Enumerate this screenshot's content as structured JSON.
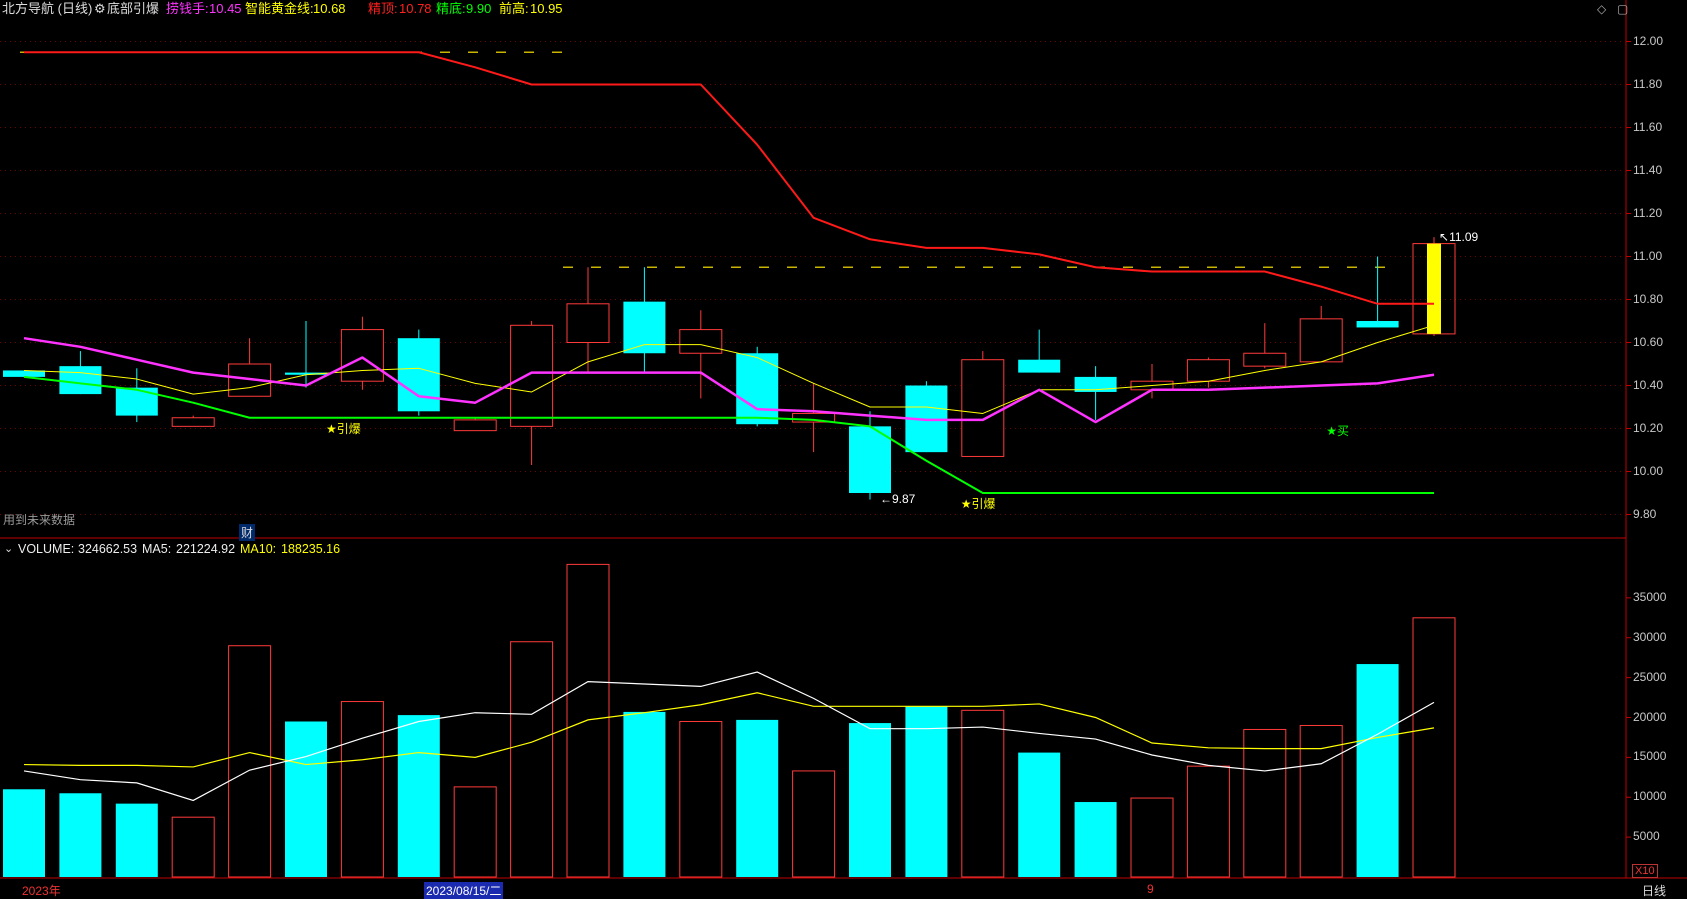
{
  "header": {
    "title": "北方导航 (日线)",
    "indicator_name": "底部引爆",
    "items": [
      {
        "label": "捞钱手:",
        "value": "10.45",
        "color": "#ff33ff"
      },
      {
        "label": "智能黄金线:",
        "value": "10.68",
        "color": "#ffff00"
      },
      {
        "label": "精顶:",
        "value": "10.78",
        "color": "#ff2020"
      },
      {
        "label": "精底:",
        "value": "9.90",
        "color": "#00ff00"
      },
      {
        "label": "前高:",
        "value": "10.95",
        "color": "#ffff00"
      }
    ]
  },
  "volume_header": {
    "label": "VOLUME:",
    "value": "324662.53",
    "ma5_label": "MA5:",
    "ma5_value": "221224.92",
    "ma10_label": "MA10:",
    "ma10_value": "188235.16"
  },
  "annotations": {
    "future_data": "用到未来数据",
    "finance_marker": "财",
    "ignite1": "★引爆",
    "ignite2": "★引爆",
    "buy": "★买",
    "high_label": "11.09",
    "low_label": "9.87",
    "x10": "X10",
    "period": "日线"
  },
  "x_axis": {
    "year": "2023年",
    "cursor_date": "2023/08/15/二",
    "month": "9"
  },
  "price_axis": [
    "12.00",
    "11.80",
    "11.60",
    "11.40",
    "11.20",
    "11.00",
    "10.80",
    "10.60",
    "10.40",
    "10.20",
    "10.00",
    "9.80"
  ],
  "volume_axis": [
    "35000",
    "30000",
    "25000",
    "20000",
    "15000",
    "10000",
    "5000"
  ],
  "colors": {
    "up": "#ff3a3a",
    "down": "#00ffff",
    "last": "#ffff00",
    "grid": "#6e0000",
    "axis": "#c00000"
  },
  "chart_data": {
    "type": "candlestick",
    "candles": [
      {
        "o": 10.47,
        "h": 10.47,
        "l": 10.44,
        "c": 10.44
      },
      {
        "o": 10.49,
        "h": 10.56,
        "l": 10.36,
        "c": 10.36
      },
      {
        "o": 10.39,
        "h": 10.48,
        "l": 10.23,
        "c": 10.26
      },
      {
        "o": 10.21,
        "h": 10.26,
        "l": 10.21,
        "c": 10.25
      },
      {
        "o": 10.35,
        "h": 10.62,
        "l": 10.35,
        "c": 10.5
      },
      {
        "o": 10.46,
        "h": 10.7,
        "l": 10.39,
        "c": 10.45
      },
      {
        "o": 10.42,
        "h": 10.72,
        "l": 10.38,
        "c": 10.66
      },
      {
        "o": 10.62,
        "h": 10.66,
        "l": 10.26,
        "c": 10.28
      },
      {
        "o": 10.19,
        "h": 10.25,
        "l": 10.19,
        "c": 10.24
      },
      {
        "o": 10.21,
        "h": 10.7,
        "l": 10.03,
        "c": 10.68
      },
      {
        "o": 10.6,
        "h": 10.95,
        "l": 10.46,
        "c": 10.78
      },
      {
        "o": 10.79,
        "h": 10.95,
        "l": 10.46,
        "c": 10.55
      },
      {
        "o": 10.55,
        "h": 10.75,
        "l": 10.34,
        "c": 10.66
      },
      {
        "o": 10.55,
        "h": 10.58,
        "l": 10.21,
        "c": 10.22
      },
      {
        "o": 10.23,
        "h": 10.41,
        "l": 10.09,
        "c": 10.27
      },
      {
        "o": 10.21,
        "h": 10.28,
        "l": 9.87,
        "c": 9.9
      },
      {
        "o": 10.4,
        "h": 10.42,
        "l": 10.09,
        "c": 10.09
      },
      {
        "o": 10.07,
        "h": 10.56,
        "l": 10.07,
        "c": 10.52
      },
      {
        "o": 10.52,
        "h": 10.66,
        "l": 10.46,
        "c": 10.46
      },
      {
        "o": 10.44,
        "h": 10.49,
        "l": 10.24,
        "c": 10.37
      },
      {
        "o": 10.38,
        "h": 10.5,
        "l": 10.34,
        "c": 10.42
      },
      {
        "o": 10.42,
        "h": 10.53,
        "l": 10.39,
        "c": 10.52
      },
      {
        "o": 10.49,
        "h": 10.69,
        "l": 10.48,
        "c": 10.55
      },
      {
        "o": 10.51,
        "h": 10.77,
        "l": 10.51,
        "c": 10.71
      },
      {
        "o": 10.7,
        "h": 11.0,
        "l": 10.68,
        "c": 10.67
      },
      {
        "o": 10.64,
        "h": 11.09,
        "l": 10.63,
        "c": 11.06
      }
    ],
    "jingding": [
      11.95,
      11.95,
      11.95,
      11.95,
      11.95,
      11.95,
      11.95,
      11.95,
      11.88,
      11.8,
      11.8,
      11.8,
      11.8,
      11.52,
      11.18,
      11.08,
      11.04,
      11.04,
      11.01,
      10.95,
      10.93,
      10.93,
      10.93,
      10.86,
      10.78,
      10.78
    ],
    "jingdi": [
      10.44,
      10.41,
      10.38,
      10.32,
      10.25,
      10.25,
      10.25,
      10.25,
      10.25,
      10.25,
      10.25,
      10.25,
      10.25,
      10.25,
      10.24,
      10.21,
      10.05,
      9.9,
      9.9,
      9.9,
      9.9,
      9.9,
      9.9,
      9.9,
      9.9,
      9.9
    ],
    "laoqianshou": [
      10.62,
      10.58,
      10.52,
      10.46,
      10.43,
      10.4,
      10.53,
      10.35,
      10.32,
      10.46,
      10.46,
      10.46,
      10.46,
      10.29,
      10.28,
      10.26,
      10.24,
      10.24,
      10.38,
      10.23,
      10.38,
      10.38,
      10.39,
      10.4,
      10.41,
      10.45
    ],
    "golden_line": [
      10.47,
      10.46,
      10.43,
      10.36,
      10.39,
      10.45,
      10.47,
      10.48,
      10.41,
      10.37,
      10.51,
      10.59,
      10.59,
      10.53,
      10.41,
      10.3,
      10.3,
      10.27,
      10.38,
      10.38,
      10.4,
      10.42,
      10.47,
      10.51,
      10.6,
      10.68
    ],
    "prev_high": 10.95,
    "prev_high_from_index": 10,
    "volume": [
      11000,
      10500,
      9200,
      7500,
      29000,
      19500,
      22000,
      20300,
      11300,
      29500,
      39200,
      20700,
      19500,
      19700,
      13300,
      19300,
      21400,
      20900,
      15600,
      9400,
      9900,
      13900,
      18500,
      19000,
      26700,
      32500
    ],
    "vol_ma5": [
      13300,
      12200,
      11800,
      9600,
      13400,
      15100,
      17400,
      19500,
      20600,
      20400,
      24500,
      24200,
      23900,
      25700,
      22400,
      18600,
      18600,
      18800,
      18000,
      17300,
      15300,
      14000,
      13300,
      14200,
      17900,
      21900
    ],
    "vol_ma10": [
      14100,
      14000,
      14000,
      13800,
      15600,
      14100,
      14700,
      15600,
      15000,
      16900,
      19700,
      20600,
      21600,
      23100,
      21400,
      21400,
      21400,
      21400,
      21700,
      20000,
      16800,
      16200,
      16100,
      16100,
      17500,
      18700
    ],
    "price_range": [
      9.7,
      12.1
    ],
    "volume_range": [
      0,
      40000
    ]
  }
}
